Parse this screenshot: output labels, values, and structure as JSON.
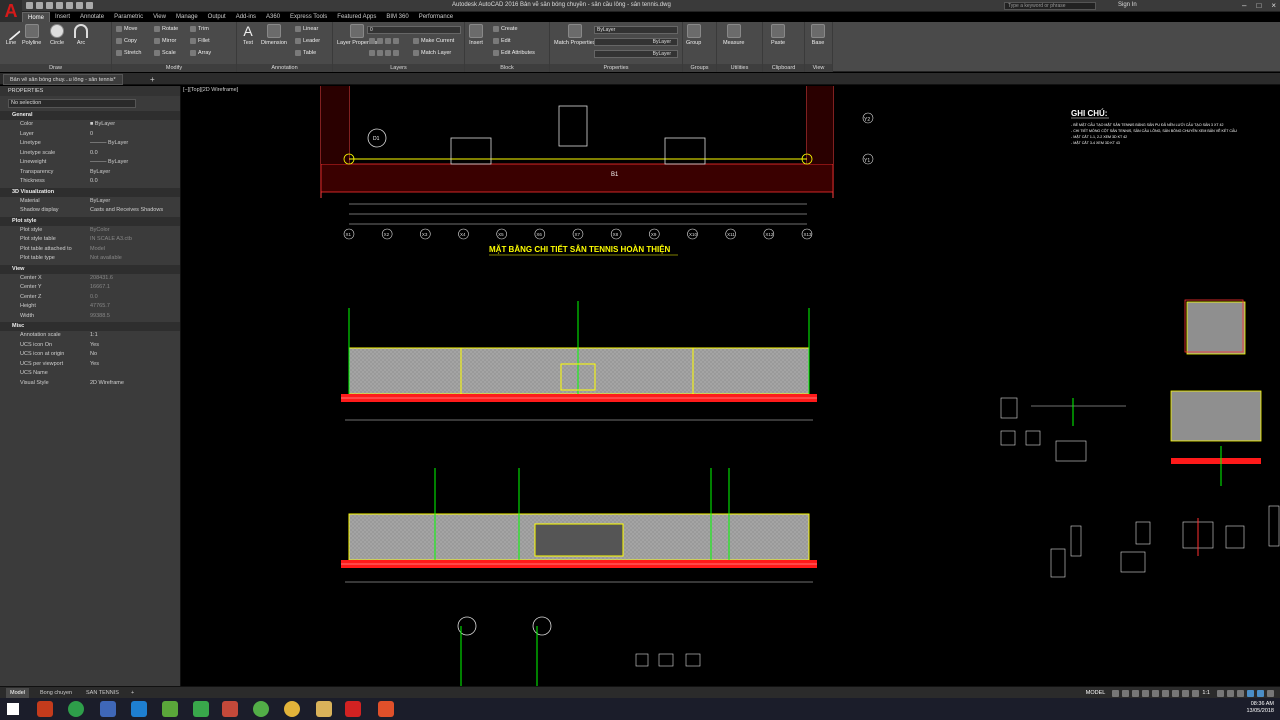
{
  "window": {
    "title": "Autodesk AutoCAD 2016    Bản vẽ sân bóng chuyền - sân cầu lông - sân tennis.dwg",
    "search_placeholder": "Type a keyword or phrase",
    "sign_in": "Sign In"
  },
  "ribbon_tabs": [
    "Home",
    "Insert",
    "Annotate",
    "Parametric",
    "View",
    "Manage",
    "Output",
    "Add-ins",
    "A360",
    "Express Tools",
    "Featured Apps",
    "BIM 360",
    "Performance"
  ],
  "ribbon": {
    "draw": {
      "title": "Draw",
      "line": "Line",
      "polyline": "Polyline",
      "circle": "Circle",
      "arc": "Arc"
    },
    "modify": {
      "title": "Modify",
      "move": "Move",
      "rotate": "Rotate",
      "trim": "Trim",
      "copy": "Copy",
      "mirror": "Mirror",
      "fillet": "Fillet",
      "stretch": "Stretch",
      "scale": "Scale",
      "array": "Array"
    },
    "annotation": {
      "title": "Annotation",
      "text": "Text",
      "dimension": "Dimension",
      "linear": "Linear",
      "leader": "Leader",
      "table": "Table"
    },
    "layers": {
      "title": "Layers",
      "layer_properties": "Layer Properties",
      "current_layer": "0",
      "make_current": "Make Current",
      "match_layer": "Match Layer"
    },
    "block": {
      "title": "Block",
      "insert": "Insert",
      "create": "Create",
      "edit": "Edit",
      "edit_attributes": "Edit Attributes"
    },
    "properties": {
      "title": "Properties",
      "match_properties": "Match Properties",
      "color": "ByLayer",
      "linetype": "ByLayer",
      "lineweight": "ByLayer"
    },
    "groups": {
      "title": "Groups",
      "group": "Group"
    },
    "utilities": {
      "title": "Utilities",
      "measure": "Measure"
    },
    "clipboard": {
      "title": "Clipboard",
      "paste": "Paste"
    },
    "view": {
      "title": "View",
      "base": "Base"
    }
  },
  "file_tab": {
    "label": "Bản vẽ sân bóng chuy...u lông - sân tennis*"
  },
  "properties_palette": {
    "title": "PROPERTIES",
    "selection": "No selection",
    "sections": [
      {
        "name": "General",
        "rows": [
          [
            "Color",
            "■ ByLayer"
          ],
          [
            "Layer",
            "0"
          ],
          [
            "Linetype",
            "——— ByLayer"
          ],
          [
            "Linetype scale",
            "0.0"
          ],
          [
            "Lineweight",
            "——— ByLayer"
          ],
          [
            "Transparency",
            "ByLayer"
          ],
          [
            "Thickness",
            "0.0"
          ]
        ]
      },
      {
        "name": "3D Visualization",
        "rows": [
          [
            "Material",
            "ByLayer"
          ],
          [
            "Shadow display",
            "Casts and Receives Shadows"
          ]
        ]
      },
      {
        "name": "Plot style",
        "rows": [
          [
            "Plot style",
            "ByColor"
          ],
          [
            "Plot style table",
            "IN SCALE A3.ctb"
          ],
          [
            "Plot table attached to",
            "Model"
          ],
          [
            "Plot table type",
            "Not available"
          ]
        ]
      },
      {
        "name": "View",
        "rows": [
          [
            "Center X",
            "208431.6"
          ],
          [
            "Center Y",
            "16667.1"
          ],
          [
            "Center Z",
            "0.0"
          ],
          [
            "Height",
            "47765.7"
          ],
          [
            "Width",
            "99388.5"
          ]
        ]
      },
      {
        "name": "Misc",
        "rows": [
          [
            "Annotation scale",
            "1:1"
          ],
          [
            "UCS icon On",
            "Yes"
          ],
          [
            "UCS icon at origin",
            "No"
          ],
          [
            "UCS per viewport",
            "Yes"
          ],
          [
            "UCS Name",
            ""
          ],
          [
            "Visual Style",
            "2D Wireframe"
          ]
        ]
      }
    ]
  },
  "viewport": {
    "label": "[−][Top][2D Wireframe]",
    "plan_title": "MẶT BẰNG CHI TIẾT SÂN TENNIS HOÀN THIỆN",
    "notes_title": "GHI CHÚ:",
    "notes": [
      "- BỀ MẶT CẤU TẠO MẶT SÂN TENNIS BẰNG SÂN PU ĐÃ NỀN LƯỚI CẤU TẠO SÂN 3 XT 42",
      "- CHI TIẾT MÓNG CỘT SÂN TENNIS, SÂN CẦU LÔNG, SÂN BÓNG CHUYỀN XEM BẢN VẼ KẾT CẤU",
      "- MẶT CẮT 1-1, 2-2 XEM 3D KT 42",
      "- MẶT CẮT 3-4 XEM 3D KT 43"
    ],
    "grid_labels": [
      "X1",
      "X2",
      "X3",
      "X4",
      "X5",
      "X6",
      "X7",
      "X8",
      "X9",
      "X10",
      "X11",
      "X12",
      "X13"
    ],
    "row_labels": [
      "Y2",
      "Y1"
    ],
    "section_marks": [
      "D1",
      "B1"
    ]
  },
  "layout_tabs": [
    "Model",
    "Bong chuyen",
    "SAN TENNIS"
  ],
  "status": {
    "mode": "MODEL",
    "scale": "1:1"
  },
  "clock": {
    "time": "08:36 AM",
    "date": "13/05/2018"
  },
  "colors": {
    "ribbon_bg": "#4a4a4a",
    "palette_bg": "#3b3b3b",
    "canvas": "#000000",
    "accent": "#d51a1a",
    "cad_yellow": "#ffff00",
    "cad_red": "#ff0000",
    "cad_green": "#00ff00"
  }
}
